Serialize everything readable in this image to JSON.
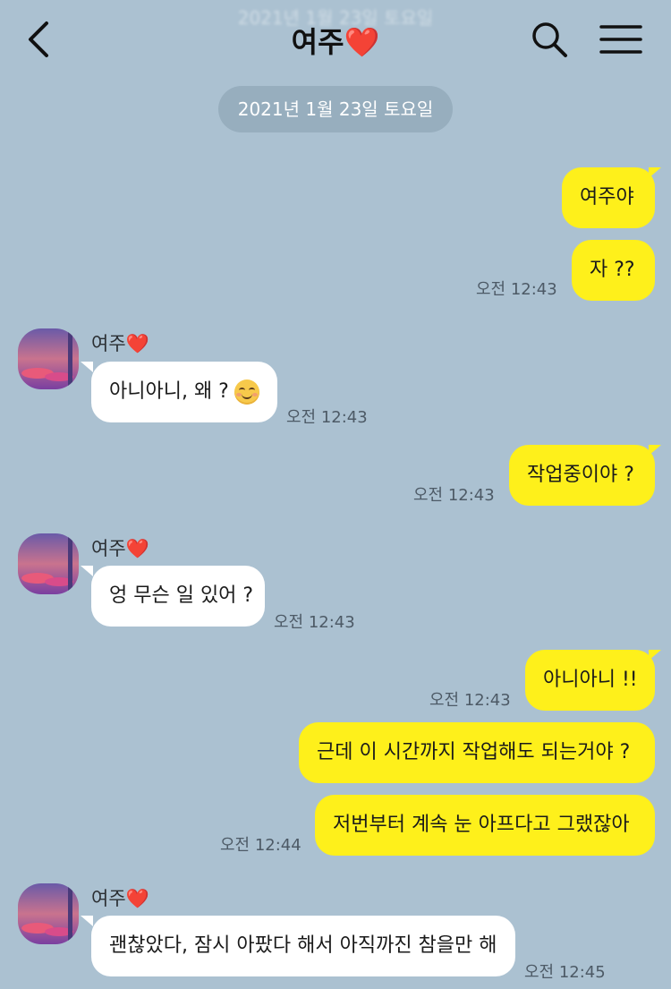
{
  "header": {
    "ghost_date": "2021년 1월 23일 토요일",
    "title": "여주",
    "title_emoji": "❤️"
  },
  "date_divider": "2021년 1월 23일 토요일",
  "contact": {
    "name": "여주",
    "name_emoji": "❤️"
  },
  "messages": [
    {
      "from": "me",
      "text": "여주야"
    },
    {
      "from": "me",
      "text": "자 ??",
      "time": "오전 12:43"
    },
    {
      "from": "them",
      "text": "아니아니, 왜 ?",
      "emoji": "smiling-face-icon",
      "time": "오전 12:43"
    },
    {
      "from": "me",
      "text": "작업중이야 ?",
      "time": "오전 12:43"
    },
    {
      "from": "them",
      "text": "엉 무슨 일 있어 ?",
      "time": "오전 12:43"
    },
    {
      "from": "me",
      "text": "아니아니 !!",
      "time": "오전 12:43"
    },
    {
      "from": "me",
      "text": "근데 이 시간까지 작업해도 되는거야 ?"
    },
    {
      "from": "me",
      "text": "저번부터 계속 눈 아프다고 그랬잖아",
      "time": "오전 12:44"
    },
    {
      "from": "them",
      "text": "괜찮았다, 잠시 아팠다 해서 아직까진 참을만 해",
      "time": "오전 12:45"
    }
  ],
  "colors": {
    "background": "#abc1d1",
    "my_bubble": "#fef01b",
    "their_bubble": "#ffffff",
    "date_pill": "#97aebe",
    "heart": "#e0202c"
  }
}
